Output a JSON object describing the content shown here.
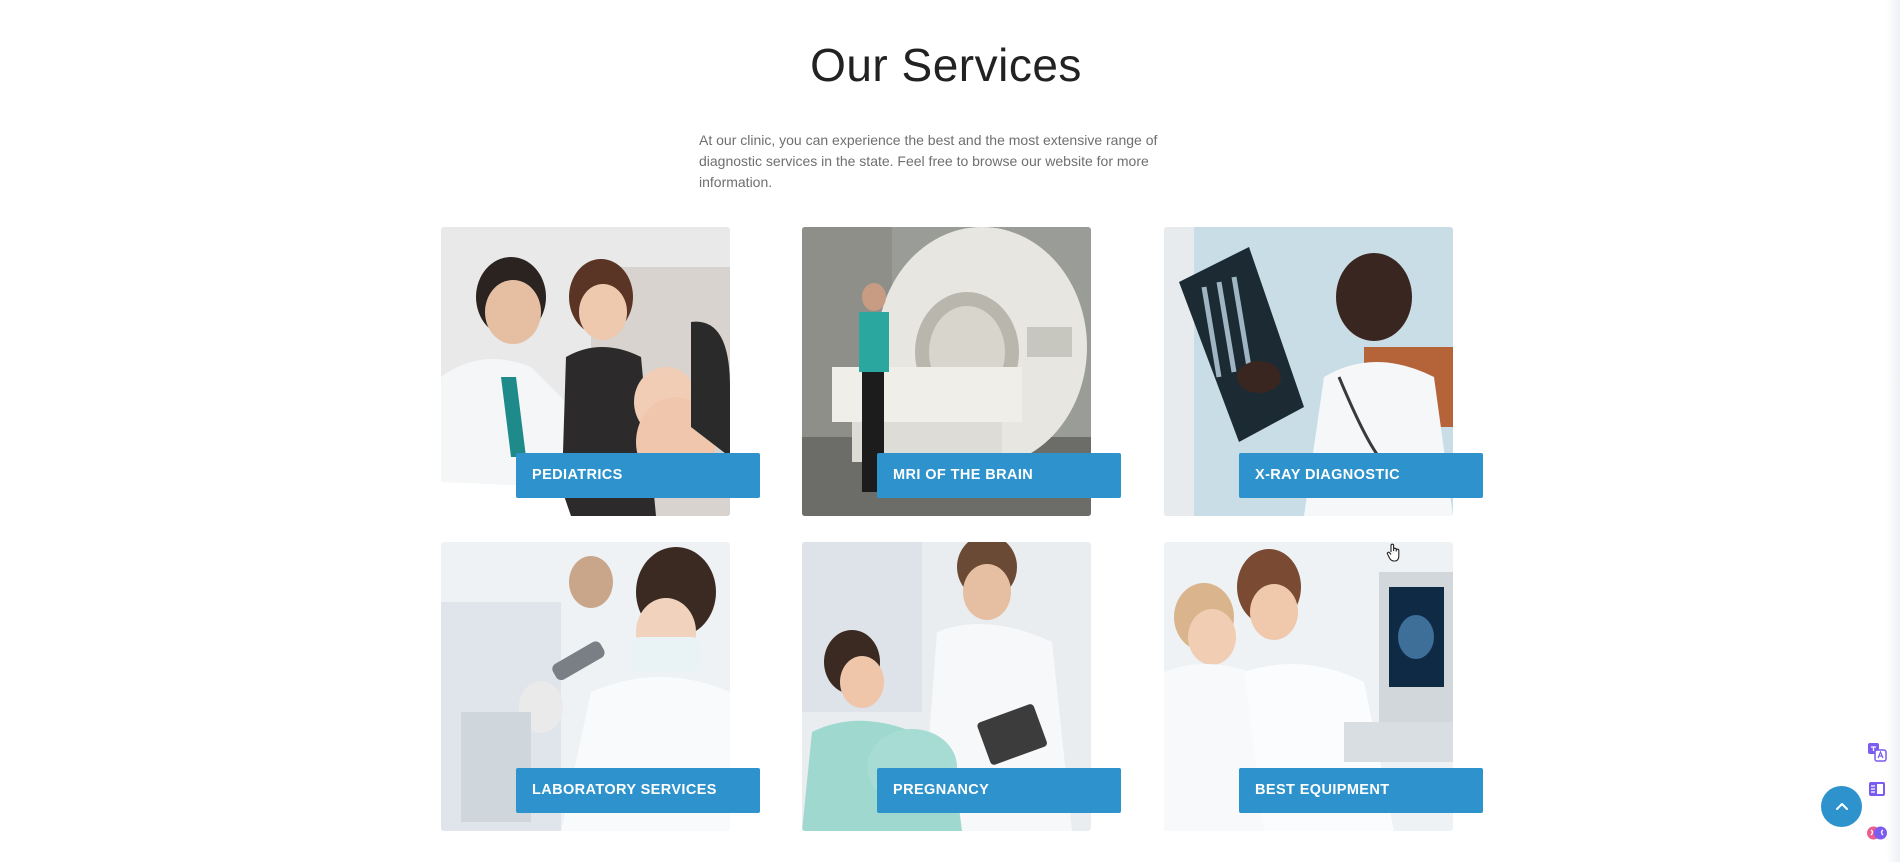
{
  "section": {
    "title": "Our Services",
    "intro": "At our clinic, you can experience the best and the most extensive range of diagnostic services in the state. Feel free to browse our website for more information."
  },
  "services": [
    {
      "label": "PEDIATRICS",
      "image": "pediatrician-examining-baby-photo"
    },
    {
      "label": "MRI OF THE BRAIN",
      "image": "mri-scanner-photo"
    },
    {
      "label": "X-RAY DIAGNOSTIC",
      "image": "doctor-reviewing-xray-photo"
    },
    {
      "label": "LABORATORY SERVICES",
      "image": "lab-technician-microscope-photo"
    },
    {
      "label": "PREGNANCY",
      "image": "doctor-with-pregnant-patient-photo"
    },
    {
      "label": "BEST EQUIPMENT",
      "image": "ultrasound-equipment-photo"
    }
  ],
  "widgets": {
    "back_to_top_icon": "chevron-up-icon",
    "side_tools": [
      "translate-icon",
      "reader-icon",
      "ai-brain-icon"
    ]
  },
  "colors": {
    "accent": "#2e93cd",
    "title": "#222222",
    "body_text": "#6f6f6f"
  }
}
